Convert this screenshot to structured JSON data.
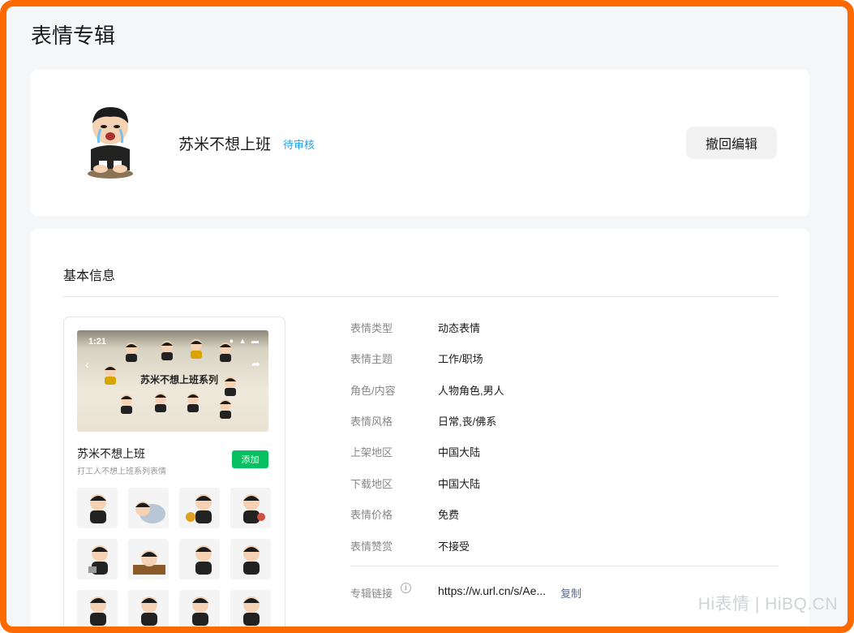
{
  "page": {
    "title": "表情专辑"
  },
  "album": {
    "name": "苏米不想上班",
    "status": "待审核",
    "withdraw_label": "撤回编辑"
  },
  "basic_info": {
    "section_title": "基本信息",
    "preview": {
      "status_time": "1:21",
      "status_icons": "● ▲ ▬",
      "banner_title": "苏米不想上班系列",
      "name": "苏米不想上班",
      "subtitle": "打工人不想上班系列表情",
      "add_label": "添加"
    },
    "fields": [
      {
        "label": "表情类型",
        "value": "动态表情"
      },
      {
        "label": "表情主题",
        "value": "工作/职场"
      },
      {
        "label": "角色/内容",
        "value": "人物角色,男人"
      },
      {
        "label": "表情风格",
        "value": "日常,丧/佛系"
      },
      {
        "label": "上架地区",
        "value": "中国大陆"
      },
      {
        "label": "下载地区",
        "value": "中国大陆"
      },
      {
        "label": "表情价格",
        "value": "免费"
      },
      {
        "label": "表情赞赏",
        "value": "不接受"
      }
    ],
    "link": {
      "label": "专辑链接",
      "value": "https://w.url.cn/s/Ae...",
      "copy_label": "复制"
    }
  },
  "watermark": "Hi表情 | HiBQ.CN",
  "colors": {
    "frame": "#ff6a00",
    "status": "#1aa3e8",
    "add_button": "#07c160",
    "copy_link": "#576b95"
  }
}
